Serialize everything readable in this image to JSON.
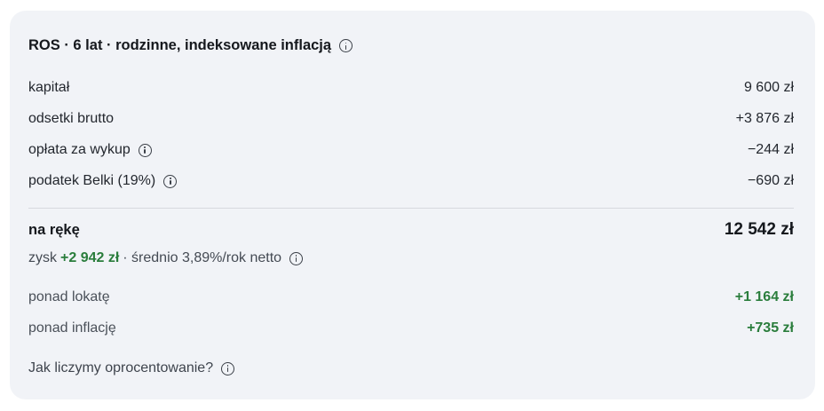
{
  "card": {
    "title": "ROS · 6 lat · rodzinne, indeksowane inflacją",
    "rows": [
      {
        "label": "kapitał",
        "value": "9 600 zł"
      },
      {
        "label": "odsetki brutto",
        "value": "+3 876 zł"
      },
      {
        "label": "opłata za wykup",
        "value": "−244 zł"
      },
      {
        "label": "podatek Belki (19%)",
        "value": "−690 zł"
      }
    ],
    "net": {
      "label": "na rękę",
      "value": "12 542 zł"
    },
    "summary": {
      "prefix": "zysk",
      "gain": "+2 942 zł",
      "suffix": "· średnio 3,89%/rok netto"
    },
    "comparisons": [
      {
        "label": "ponad lokatę",
        "value": "+1 164 zł"
      },
      {
        "label": "ponad inflację",
        "value": "+735 zł"
      }
    ],
    "faq_link": "Jak liczymy oprocentowanie?"
  },
  "icons": {
    "info": "info-icon"
  },
  "colors": {
    "card_bg": "#f1f3f7",
    "positive": "#2a7d3c",
    "text": "#1b1e24"
  }
}
